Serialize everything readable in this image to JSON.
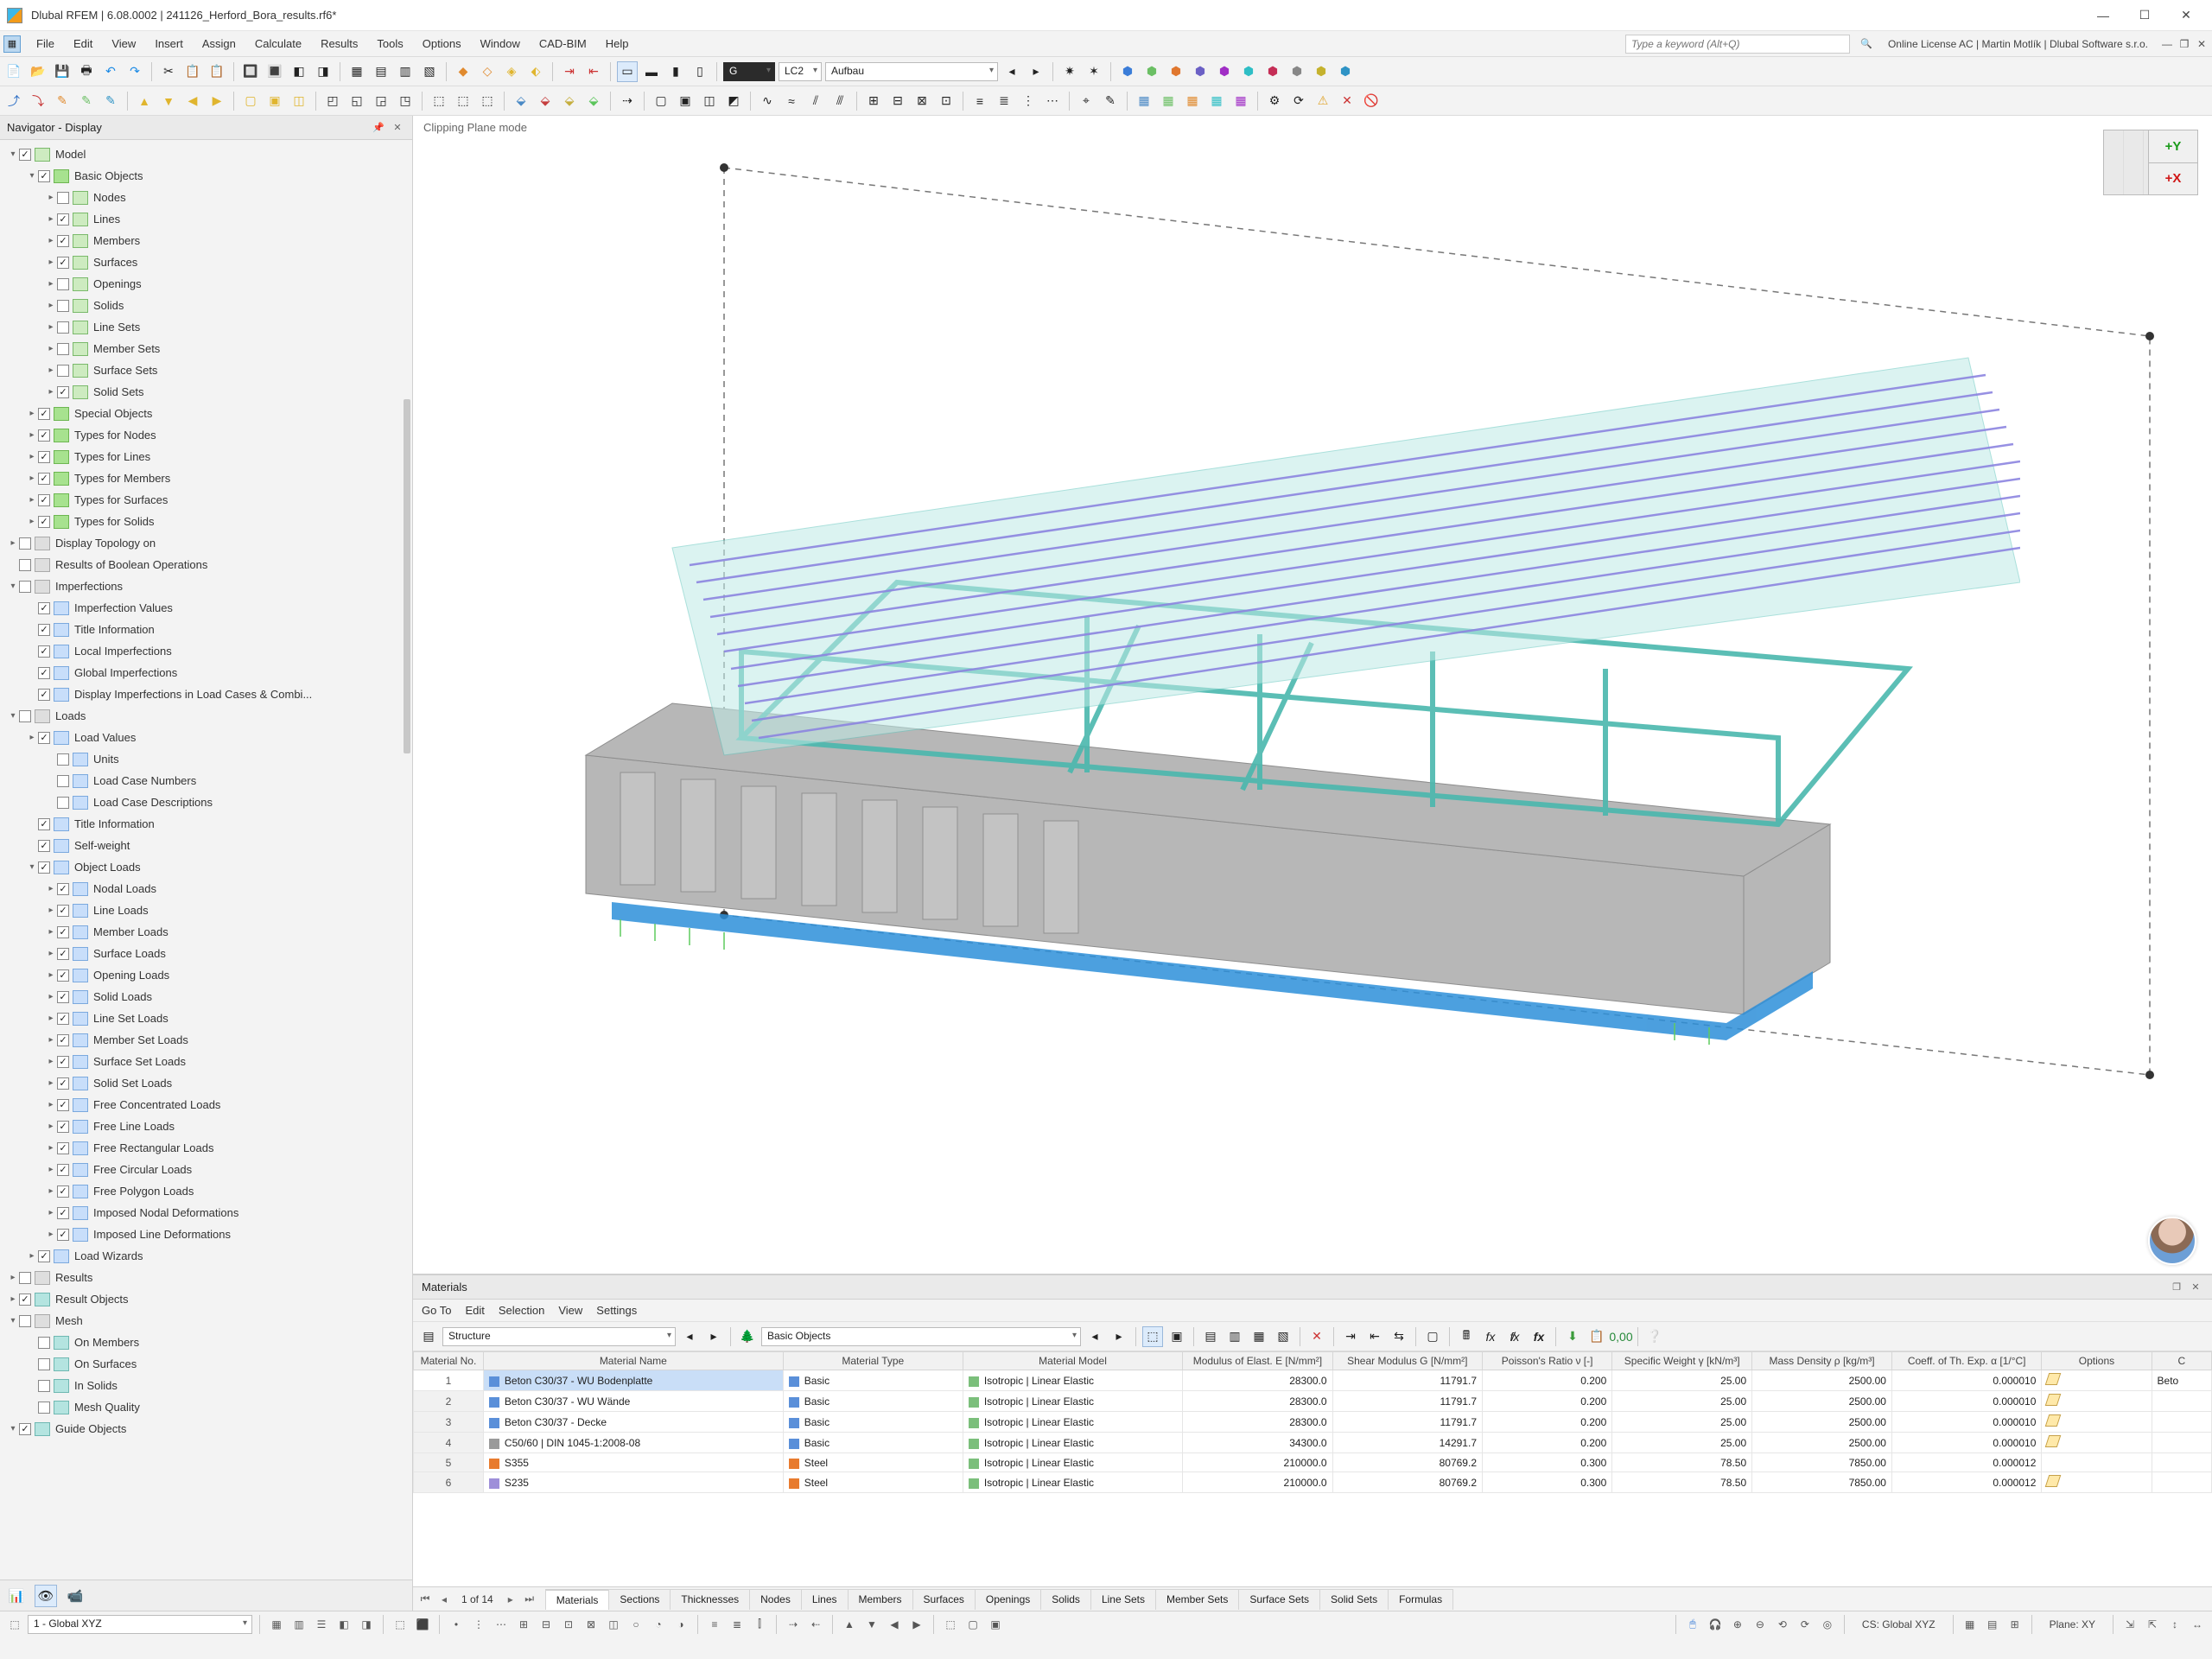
{
  "title": "Dlubal RFEM | 6.08.0002 | 241126_Herford_Bora_results.rf6*",
  "menu": [
    "File",
    "Edit",
    "View",
    "Insert",
    "Assign",
    "Calculate",
    "Results",
    "Tools",
    "Options",
    "Window",
    "CAD-BIM",
    "Help"
  ],
  "keyword_placeholder": "Type a keyword (Alt+Q)",
  "license": "Online License AC | Martin Motlík | Dlubal Software s.r.o.",
  "toolbar_combo_g": "G",
  "toolbar_combo_lc": "LC2",
  "toolbar_combo_name": "Aufbau",
  "navigator": {
    "title": "Navigator - Display",
    "items": [
      {
        "d": 0,
        "tw": "▾",
        "cb": "on",
        "ic": "green",
        "label": "Model"
      },
      {
        "d": 1,
        "tw": "▾",
        "cb": "on",
        "ic": "lime",
        "label": "Basic Objects"
      },
      {
        "d": 2,
        "tw": "▸",
        "cb": "off",
        "ic": "green",
        "label": "Nodes"
      },
      {
        "d": 2,
        "tw": "▸",
        "cb": "on",
        "ic": "green",
        "label": "Lines"
      },
      {
        "d": 2,
        "tw": "▸",
        "cb": "on",
        "ic": "green",
        "label": "Members"
      },
      {
        "d": 2,
        "tw": "▸",
        "cb": "on",
        "ic": "green",
        "label": "Surfaces"
      },
      {
        "d": 2,
        "tw": "▸",
        "cb": "off",
        "ic": "green",
        "label": "Openings"
      },
      {
        "d": 2,
        "tw": "▸",
        "cb": "off",
        "ic": "green",
        "label": "Solids"
      },
      {
        "d": 2,
        "tw": "▸",
        "cb": "off",
        "ic": "green",
        "label": "Line Sets"
      },
      {
        "d": 2,
        "tw": "▸",
        "cb": "off",
        "ic": "green",
        "label": "Member Sets"
      },
      {
        "d": 2,
        "tw": "▸",
        "cb": "off",
        "ic": "green",
        "label": "Surface Sets"
      },
      {
        "d": 2,
        "tw": "▸",
        "cb": "on",
        "ic": "green",
        "label": "Solid Sets"
      },
      {
        "d": 1,
        "tw": "▸",
        "cb": "on",
        "ic": "lime",
        "label": "Special Objects"
      },
      {
        "d": 1,
        "tw": "▸",
        "cb": "on",
        "ic": "lime",
        "label": "Types for Nodes"
      },
      {
        "d": 1,
        "tw": "▸",
        "cb": "on",
        "ic": "lime",
        "label": "Types for Lines"
      },
      {
        "d": 1,
        "tw": "▸",
        "cb": "on",
        "ic": "lime",
        "label": "Types for Members"
      },
      {
        "d": 1,
        "tw": "▸",
        "cb": "on",
        "ic": "lime",
        "label": "Types for Surfaces"
      },
      {
        "d": 1,
        "tw": "▸",
        "cb": "on",
        "ic": "lime",
        "label": "Types for Solids"
      },
      {
        "d": 0,
        "tw": "▸",
        "cb": "off",
        "ic": "gray",
        "label": "Display Topology on"
      },
      {
        "d": 0,
        "tw": "",
        "cb": "off",
        "ic": "gray",
        "label": "Results of Boolean Operations"
      },
      {
        "d": 0,
        "tw": "▾",
        "cb": "off",
        "ic": "gray",
        "label": "Imperfections"
      },
      {
        "d": 1,
        "tw": "",
        "cb": "on",
        "ic": "blue",
        "label": "Imperfection Values"
      },
      {
        "d": 1,
        "tw": "",
        "cb": "on",
        "ic": "blue",
        "label": "Title Information"
      },
      {
        "d": 1,
        "tw": "",
        "cb": "on",
        "ic": "blue",
        "label": "Local Imperfections"
      },
      {
        "d": 1,
        "tw": "",
        "cb": "on",
        "ic": "blue",
        "label": "Global Imperfections"
      },
      {
        "d": 1,
        "tw": "",
        "cb": "on",
        "ic": "blue",
        "label": "Display Imperfections in Load Cases & Combi..."
      },
      {
        "d": 0,
        "tw": "▾",
        "cb": "off",
        "ic": "gray",
        "label": "Loads"
      },
      {
        "d": 1,
        "tw": "▸",
        "cb": "on",
        "ic": "blue",
        "label": "Load Values"
      },
      {
        "d": 2,
        "tw": "",
        "cb": "off",
        "ic": "blue",
        "label": "Units"
      },
      {
        "d": 2,
        "tw": "",
        "cb": "off",
        "ic": "blue",
        "label": "Load Case Numbers"
      },
      {
        "d": 2,
        "tw": "",
        "cb": "off",
        "ic": "blue",
        "label": "Load Case Descriptions"
      },
      {
        "d": 1,
        "tw": "",
        "cb": "on",
        "ic": "blue",
        "label": "Title Information"
      },
      {
        "d": 1,
        "tw": "",
        "cb": "on",
        "ic": "blue",
        "label": "Self-weight"
      },
      {
        "d": 1,
        "tw": "▾",
        "cb": "on",
        "ic": "blue",
        "label": "Object Loads"
      },
      {
        "d": 2,
        "tw": "▸",
        "cb": "on",
        "ic": "blue",
        "label": "Nodal Loads"
      },
      {
        "d": 2,
        "tw": "▸",
        "cb": "on",
        "ic": "blue",
        "label": "Line Loads"
      },
      {
        "d": 2,
        "tw": "▸",
        "cb": "on",
        "ic": "blue",
        "label": "Member Loads"
      },
      {
        "d": 2,
        "tw": "▸",
        "cb": "on",
        "ic": "blue",
        "label": "Surface Loads"
      },
      {
        "d": 2,
        "tw": "▸",
        "cb": "on",
        "ic": "blue",
        "label": "Opening Loads"
      },
      {
        "d": 2,
        "tw": "▸",
        "cb": "on",
        "ic": "blue",
        "label": "Solid Loads"
      },
      {
        "d": 2,
        "tw": "▸",
        "cb": "on",
        "ic": "blue",
        "label": "Line Set Loads"
      },
      {
        "d": 2,
        "tw": "▸",
        "cb": "on",
        "ic": "blue",
        "label": "Member Set Loads"
      },
      {
        "d": 2,
        "tw": "▸",
        "cb": "on",
        "ic": "blue",
        "label": "Surface Set Loads"
      },
      {
        "d": 2,
        "tw": "▸",
        "cb": "on",
        "ic": "blue",
        "label": "Solid Set Loads"
      },
      {
        "d": 2,
        "tw": "▸",
        "cb": "on",
        "ic": "blue",
        "label": "Free Concentrated Loads"
      },
      {
        "d": 2,
        "tw": "▸",
        "cb": "on",
        "ic": "blue",
        "label": "Free Line Loads"
      },
      {
        "d": 2,
        "tw": "▸",
        "cb": "on",
        "ic": "blue",
        "label": "Free Rectangular Loads"
      },
      {
        "d": 2,
        "tw": "▸",
        "cb": "on",
        "ic": "blue",
        "label": "Free Circular Loads"
      },
      {
        "d": 2,
        "tw": "▸",
        "cb": "on",
        "ic": "blue",
        "label": "Free Polygon Loads"
      },
      {
        "d": 2,
        "tw": "▸",
        "cb": "on",
        "ic": "blue",
        "label": "Imposed Nodal Deformations"
      },
      {
        "d": 2,
        "tw": "▸",
        "cb": "on",
        "ic": "blue",
        "label": "Imposed Line Deformations"
      },
      {
        "d": 1,
        "tw": "▸",
        "cb": "on",
        "ic": "blue",
        "label": "Load Wizards"
      },
      {
        "d": 0,
        "tw": "▸",
        "cb": "off",
        "ic": "gray",
        "label": "Results"
      },
      {
        "d": 0,
        "tw": "▸",
        "cb": "on",
        "ic": "teal",
        "label": "Result Objects"
      },
      {
        "d": 0,
        "tw": "▾",
        "cb": "off",
        "ic": "gray",
        "label": "Mesh"
      },
      {
        "d": 1,
        "tw": "",
        "cb": "off",
        "ic": "teal",
        "label": "On Members"
      },
      {
        "d": 1,
        "tw": "",
        "cb": "off",
        "ic": "teal",
        "label": "On Surfaces"
      },
      {
        "d": 1,
        "tw": "",
        "cb": "off",
        "ic": "teal",
        "label": "In Solids"
      },
      {
        "d": 1,
        "tw": "",
        "cb": "off",
        "ic": "teal",
        "label": "Mesh Quality"
      },
      {
        "d": 0,
        "tw": "▾",
        "cb": "on",
        "ic": "teal",
        "label": "Guide Objects"
      }
    ]
  },
  "viewport": {
    "clip_label": "Clipping Plane mode",
    "axis_y": "+Y",
    "axis_x": "+X"
  },
  "materials_panel": {
    "title": "Materials",
    "menu": [
      "Go To",
      "Edit",
      "Selection",
      "View",
      "Settings"
    ],
    "combo1": "Structure",
    "combo2": "Basic Objects",
    "headers": {
      "no": "Material\nNo.",
      "name": "Material Name",
      "type": "Material\nType",
      "model": "Material Model",
      "e": "Modulus of Elast.\nE [N/mm²]",
      "g": "Shear Modulus\nG [N/mm²]",
      "nu": "Poisson's Ratio\nν [-]",
      "gamma": "Specific Weight\nγ [kN/m³]",
      "rho": "Mass Density\nρ [kg/m³]",
      "alpha": "Coeff. of Th. Exp.\nα [1/°C]",
      "opt": "Options",
      "c": "C"
    },
    "rows": [
      {
        "no": "1",
        "color": "#5a8fd9",
        "name": "Beton C30/37 - WU Bodenplatte",
        "type": "Basic",
        "model": "Isotropic | Linear Elastic",
        "e": "28300.0",
        "g": "11791.7",
        "nu": "0.200",
        "gamma": "25.00",
        "rho": "2500.00",
        "alpha": "0.000010",
        "opt": "edit",
        "c": "Beto"
      },
      {
        "no": "2",
        "color": "#5a8fd9",
        "name": "Beton C30/37 - WU Wände",
        "type": "Basic",
        "model": "Isotropic | Linear Elastic",
        "e": "28300.0",
        "g": "11791.7",
        "nu": "0.200",
        "gamma": "25.00",
        "rho": "2500.00",
        "alpha": "0.000010",
        "opt": "edit",
        "c": ""
      },
      {
        "no": "3",
        "color": "#5a8fd9",
        "name": "Beton C30/37 - Decke",
        "type": "Basic",
        "model": "Isotropic | Linear Elastic",
        "e": "28300.0",
        "g": "11791.7",
        "nu": "0.200",
        "gamma": "25.00",
        "rho": "2500.00",
        "alpha": "0.000010",
        "opt": "edit",
        "c": ""
      },
      {
        "no": "4",
        "color": "#9a9a9a",
        "name": "C50/60 | DIN 1045-1:2008-08",
        "type": "Basic",
        "model": "Isotropic | Linear Elastic",
        "e": "34300.0",
        "g": "14291.7",
        "nu": "0.200",
        "gamma": "25.00",
        "rho": "2500.00",
        "alpha": "0.000010",
        "opt": "edit",
        "c": ""
      },
      {
        "no": "5",
        "color": "#e87b2e",
        "name": "S355",
        "type": "Steel",
        "model": "Isotropic | Linear Elastic",
        "e": "210000.0",
        "g": "80769.2",
        "nu": "0.300",
        "gamma": "78.50",
        "rho": "7850.00",
        "alpha": "0.000012",
        "opt": "",
        "c": ""
      },
      {
        "no": "6",
        "color": "#9e8fd9",
        "name": "S235",
        "type": "Steel",
        "model": "Isotropic | Linear Elastic",
        "e": "210000.0",
        "g": "80769.2",
        "nu": "0.300",
        "gamma": "78.50",
        "rho": "7850.00",
        "alpha": "0.000012",
        "opt": "edit",
        "c": ""
      }
    ],
    "page_label": "1 of 14",
    "tabs": [
      "Materials",
      "Sections",
      "Thicknesses",
      "Nodes",
      "Lines",
      "Members",
      "Surfaces",
      "Openings",
      "Solids",
      "Line Sets",
      "Member Sets",
      "Surface Sets",
      "Solid Sets",
      "Formulas"
    ]
  },
  "statusbar": {
    "cs_combo": "1 - Global XYZ",
    "cs_label": "CS: Global XYZ",
    "plane_label": "Plane: XY"
  }
}
